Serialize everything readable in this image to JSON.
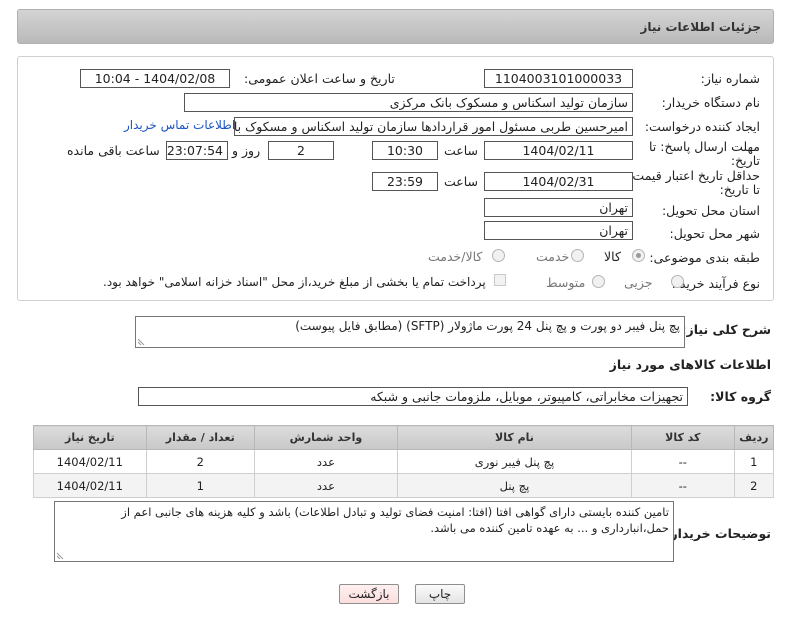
{
  "header": {
    "title": "جزئیات اطلاعات نیاز"
  },
  "form": {
    "need_number_label": "شماره نیاز:",
    "need_number": "1104003101000033",
    "announce_label": "تاریخ و ساعت اعلان عمومی:",
    "announce_value": "1404/02/08 - 10:04",
    "buyer_org_label": "نام دستگاه خریدار:",
    "buyer_org": "سازمان تولید اسکناس و مسکوک بانک مرکزی",
    "requester_label": "ایجاد کننده درخواست:",
    "requester": "امیرحسین طربی مسئول امور قراردادها سازمان تولید اسکناس و مسکوک بانک مرکزی",
    "buyer_contact_link": "اطلاعات تماس خریدار",
    "deadline_label_1": "مهلت ارسال پاسخ: تا",
    "deadline_label_2": "تاریخ:",
    "deadline_date": "1404/02/11",
    "time_label": "ساعت",
    "deadline_time": "10:30",
    "days_value": "2",
    "days_label": "روز و",
    "remaining_time": "23:07:54",
    "remaining_label": "ساعت باقی مانده",
    "validity_label_1": "حداقل تاریخ اعتبار قیمت:",
    "validity_label_2": "تا تاریخ:",
    "validity_date": "1404/02/31",
    "validity_time_label": "ساعت",
    "validity_time": "23:59",
    "province_label": "استان محل تحویل:",
    "province": "تهران",
    "city_label": "شهر محل تحویل:",
    "city": "تهران",
    "category_label": "طبقه بندی موضوعی:",
    "category_options": [
      "کالا",
      "خدمت",
      "کالا/خدمت"
    ],
    "process_label": "نوع فرآیند خرید :",
    "process_options": [
      "جزیی",
      "متوسط"
    ],
    "payment_note": "پرداخت تمام یا بخشی از مبلغ خرید،از محل \"اسناد خزانه اسلامی\" خواهد بود."
  },
  "description": {
    "label": "شرح کلی نیاز:",
    "text": "پچ پنل فیبر دو پورت و پچ پنل 24 پورت ماژولار (SFTP) (مطابق فایل پیوست)"
  },
  "goods": {
    "section_title": "اطلاعات کالاهای مورد نیاز",
    "group_label": "گروه کالا:",
    "group_value": "تجهیزات مخابراتی، کامپیوتر، موبایل، ملزومات جانبی و شبکه",
    "columns": [
      "ردیف",
      "کد کالا",
      "نام کالا",
      "واحد شمارش",
      "تعداد / مقدار",
      "تاریخ نیاز"
    ],
    "rows": [
      [
        "1",
        "--",
        "پچ پنل فیبر نوری",
        "عدد",
        "2",
        "1404/02/11"
      ],
      [
        "2",
        "--",
        "پچ پنل",
        "عدد",
        "1",
        "1404/02/11"
      ]
    ]
  },
  "buyer_notes": {
    "label": "توضیحات خریدار:",
    "text": "تامین کننده بایستی دارای گواهی افتا (افتا: امنیت فضای تولید و تبادل اطلاعات) باشد و کلیه هزینه های جانبی اعم از حمل،انبارداری و ... به عهده تامین کننده می باشد."
  },
  "buttons": {
    "print": "چاپ",
    "back": "بازگشت"
  },
  "colors": {
    "link": "#1a55c0",
    "back_button_bg": "#fde8e8"
  }
}
